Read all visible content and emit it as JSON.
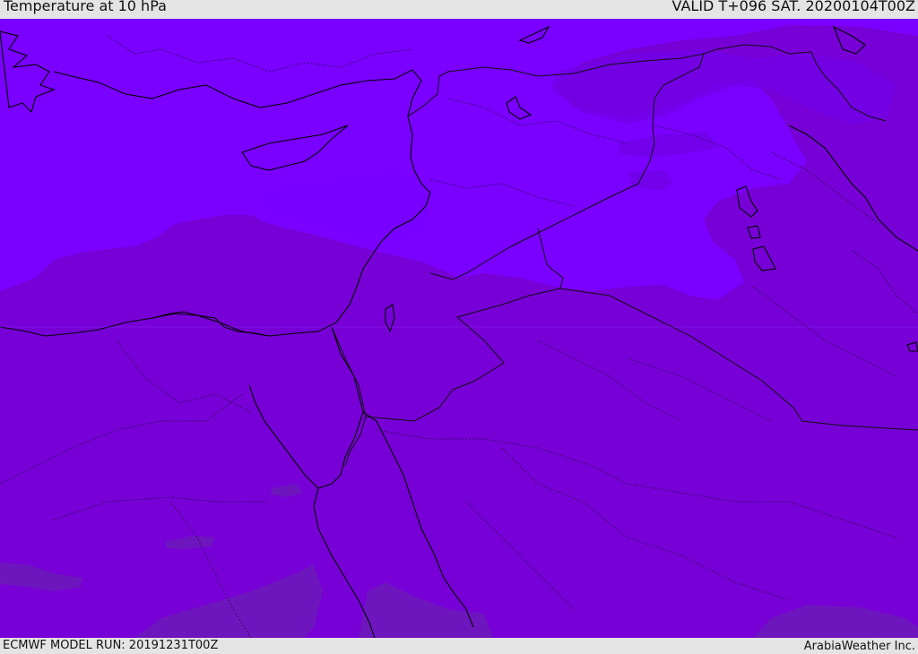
{
  "header": {
    "title": "Temperature at 10 hPa",
    "valid_time": "VALID T+096 SAT. 20200104T00Z"
  },
  "footer": {
    "model_run": "ECMWF MODEL RUN: 20191231T00Z",
    "credit": "ArabiaWeather Inc."
  },
  "colors": {
    "warmer_band": "#7a00ff",
    "base_field": "#7700d6",
    "cool_patch": "#6c1ab8",
    "coastline": "#000000",
    "borders": "#222222"
  }
}
